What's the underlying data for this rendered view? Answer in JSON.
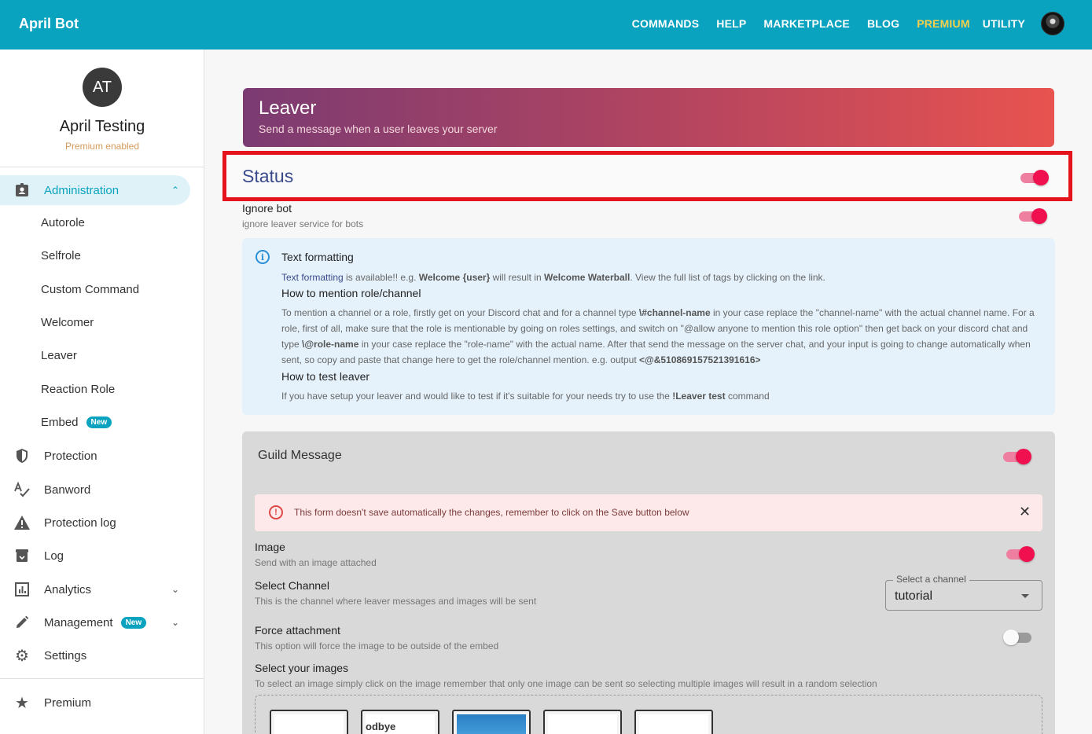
{
  "app": {
    "title": "April Bot"
  },
  "nav": {
    "items": [
      "COMMANDS",
      "HELP",
      "MARKETPLACE",
      "BLOG",
      "PREMIUM",
      "UTILITY"
    ]
  },
  "colors": {
    "topbar": "#0aa3bf",
    "premium": "#f6d04d",
    "toggle_on": "#f0104f",
    "highlight_border": "#e5141c"
  },
  "sidebar": {
    "avatar_initials": "AT",
    "server_name": "April Testing",
    "server_status": "Premium enabled",
    "items": [
      {
        "label": "Administration",
        "icon": "badge-icon",
        "active": true,
        "expanded": true
      },
      {
        "label": "Autorole"
      },
      {
        "label": "Selfrole"
      },
      {
        "label": "Custom Command"
      },
      {
        "label": "Welcomer"
      },
      {
        "label": "Leaver"
      },
      {
        "label": "Reaction Role"
      },
      {
        "label": "Embed",
        "badge": "New"
      },
      {
        "label": "Protection",
        "icon": "shield-icon"
      },
      {
        "label": "Banword",
        "icon": "spellcheck-icon"
      },
      {
        "label": "Protection log",
        "icon": "warning-icon"
      },
      {
        "label": "Log",
        "icon": "archive-icon"
      },
      {
        "label": "Analytics",
        "icon": "chart-icon"
      },
      {
        "label": "Management",
        "icon": "pencil-icon",
        "badge": "New"
      },
      {
        "label": "Settings",
        "icon": "gear-icon"
      },
      {
        "label": "Premium",
        "icon": "star-icon"
      }
    ]
  },
  "header": {
    "title": "Leaver",
    "subtitle": "Send a message when a user leaves your server"
  },
  "status": {
    "title": "Status",
    "enabled": true
  },
  "ignore_bot": {
    "title": "Ignore bot",
    "subtitle": "ignore leaver service for bots",
    "enabled": true
  },
  "info": {
    "heading1": "Text formatting",
    "p1_link": "Text formatting",
    "p1_a": " is available!! e.g. ",
    "p1_b1": "Welcome {user}",
    "p1_c": " will result in ",
    "p1_b2": "Welcome Waterball",
    "p1_d": ". View the full list of tags by clicking on the link.",
    "heading2": "How to mention role/channel",
    "p2_a": "To mention a channel or a role, firstly get on your Discord chat and for a channel type ",
    "p2_b1": "\\#channel-name",
    "p2_c": " in your case replace the \"channel-name\" with the actual channel name. For a role, first of all, make sure that the role is mentionable by going on roles settings, and switch on \"@allow anyone to mention this role option\" then get back on your discord chat and type ",
    "p2_b2": "\\@role-name",
    "p2_d": " in your case replace the \"role-name\" with the actual name. After that send the message on the server chat, and your input is going to change automatically when sent, so copy and paste that change here to get the role/channel mention. e.g. output ",
    "p2_b3": "<@&510869157521391616>",
    "heading3": "How to test leaver",
    "p3_a": "If you have setup your leaver and would like to test if it's suitable for your needs try to use the ",
    "p3_b": "!Leaver test",
    "p3_c": " command"
  },
  "guild_message": {
    "title": "Guild Message",
    "enabled": true,
    "alert": "This form doesn't save automatically the changes, remember to click on the Save button below",
    "image": {
      "title": "Image",
      "subtitle": "Send with an image attached",
      "enabled": true
    },
    "channel": {
      "title": "Select Channel",
      "subtitle": "This is the channel where leaver messages and images will be sent",
      "select_label": "Select a channel",
      "select_value": "tutorial"
    },
    "force_attachment": {
      "title": "Force attachment",
      "subtitle": "This option will force the image to be outside of the embed",
      "enabled": false
    },
    "images": {
      "title": "Select your images",
      "subtitle": "To select an image simply click on the image remember that only one image can be sent so selecting multiple images will result in a random selection",
      "thumbs": [
        "",
        "odbye",
        "",
        "",
        ""
      ]
    }
  }
}
